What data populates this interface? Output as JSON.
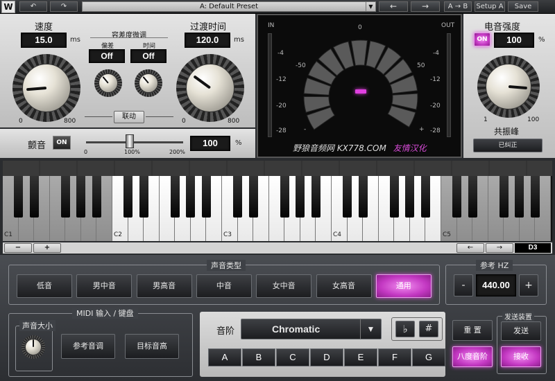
{
  "toolbar": {
    "logo": "W",
    "undo": "↶",
    "redo": "↷",
    "preset_name": "A: Default Preset",
    "preset_drop": "▼",
    "prev": "←",
    "next": "→",
    "ab": "A → B",
    "setup": "Setup A",
    "save": "Save"
  },
  "speed": {
    "label": "速度",
    "value": "15.0",
    "unit": "ms",
    "min": "0",
    "max": "800",
    "level": 0.15
  },
  "tolerance": {
    "label": "容差度微调",
    "offset_label": "偏差",
    "offset_value": "Off",
    "time_label": "时间",
    "time_value": "Off",
    "link_label": "联动"
  },
  "transition": {
    "label": "过渡时间",
    "value": "120.0",
    "unit": "ms",
    "min": "0",
    "max": "800",
    "level": 0.3
  },
  "vibrato": {
    "label": "颤音",
    "on_label": "ON",
    "value": "100",
    "unit": "%",
    "scale_min": "0",
    "scale_mid": "100%",
    "scale_max": "200%"
  },
  "meter": {
    "in_label": "IN",
    "out_label": "OUT",
    "center": "0",
    "left_mark": "-50",
    "right_mark": "50",
    "minus": "-",
    "plus": "+",
    "scale": [
      "-4",
      "-12",
      "-20",
      "-28"
    ],
    "scale_right": [
      "-4",
      "-12",
      "-20",
      "-28"
    ],
    "watermark": "野狼音频网 KX778.COM",
    "watermark2": "友情汉化",
    "readout": "▬",
    "accent": "#e040e0"
  },
  "electro": {
    "label": "电音强度",
    "on_label": "ON",
    "value": "100",
    "unit": "%",
    "min": "1",
    "max": "100",
    "resonance_label": "共振峰",
    "corrected_label": "已纠正"
  },
  "keyboard": {
    "octaves": [
      "C1",
      "C2",
      "C3",
      "C4",
      "C5"
    ],
    "minus": "−",
    "plus": "+",
    "left_arrow": "←",
    "right_arrow": "→",
    "current_note": "D3"
  },
  "voice": {
    "title": "声音类型",
    "types": [
      "低音",
      "男中音",
      "男高音",
      "中音",
      "女中音",
      "女高音",
      "通用"
    ],
    "selected": "通用"
  },
  "ref_hz": {
    "title": "参考 HZ",
    "minus": "-",
    "value": "440.00",
    "plus": "+"
  },
  "midi": {
    "title": "MIDI 输入 / 键盘",
    "volume_label": "声音大小",
    "ref_pitch": "参考音调",
    "target_pitch": "目标音高"
  },
  "scale": {
    "label": "音阶",
    "value": "Chromatic",
    "drop": "▼",
    "flat": "♭",
    "sharp": "#",
    "reset": "重 置",
    "notes": [
      "A",
      "B",
      "C",
      "D",
      "E",
      "F",
      "G"
    ],
    "octave_pitch": "八度音阶"
  },
  "send": {
    "title": "发送装置",
    "send": "发送",
    "receive": "接收"
  }
}
